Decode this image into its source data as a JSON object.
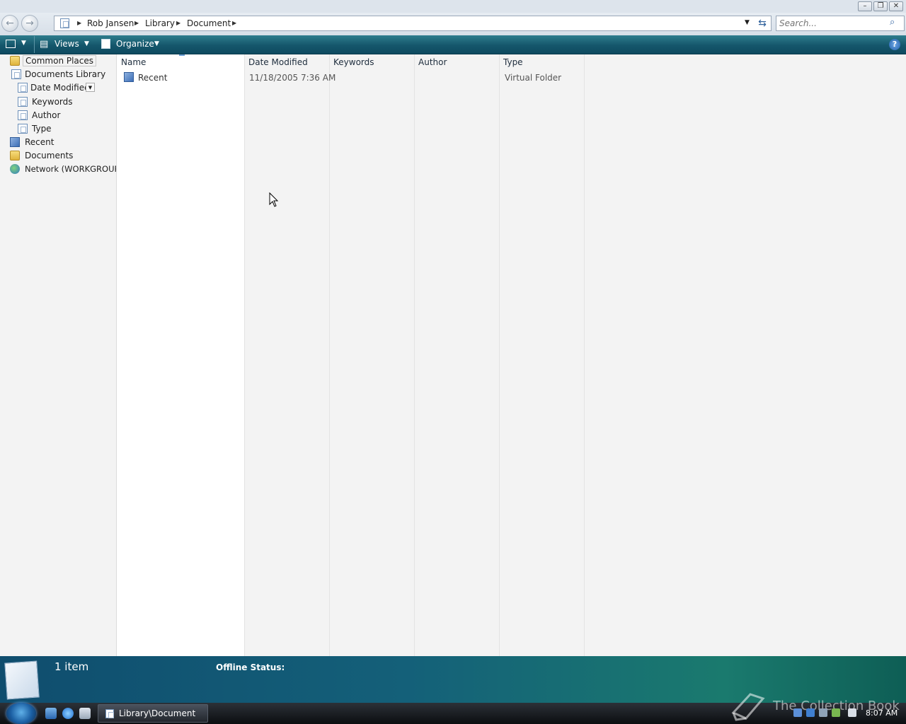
{
  "window": {
    "caption_buttons": {
      "minimize": "–",
      "restore": "❐",
      "close": "✕"
    }
  },
  "address": {
    "breadcrumbs": [
      "Rob Jansen",
      "Library",
      "Document"
    ],
    "search_placeholder": "Search..."
  },
  "toolbar": {
    "views_label": "Views",
    "organize_label": "Organize",
    "help_label": "?"
  },
  "nav": {
    "items": [
      {
        "label": "Common Places",
        "icon": "folder-icon"
      },
      {
        "label": "Documents Library",
        "icon": "document-icon"
      },
      {
        "label": "Date Modified",
        "icon": "document-icon"
      },
      {
        "label": "Keywords",
        "icon": "document-icon"
      },
      {
        "label": "Author",
        "icon": "document-icon"
      },
      {
        "label": "Type",
        "icon": "document-icon"
      },
      {
        "label": "Recent",
        "icon": "recent-folder-icon"
      },
      {
        "label": "Documents",
        "icon": "folder-icon"
      },
      {
        "label": "Network (WORKGROUP",
        "icon": "network-icon"
      }
    ]
  },
  "list": {
    "columns": [
      "Name",
      "Date Modified",
      "Keywords",
      "Author",
      "Type"
    ],
    "rows": [
      {
        "name": "Recent",
        "date_modified": "11/18/2005 7:36 AM",
        "keywords": "",
        "author": "",
        "type": "Virtual Folder"
      }
    ]
  },
  "details": {
    "item_count": "1 item",
    "offline_status_label": "Offline Status:"
  },
  "taskbar": {
    "task_button_label": "Library\\Document",
    "clock": "8:07 AM",
    "watermark": "The Collection Book"
  },
  "colors": {
    "toolbar": "#15566b",
    "details_pane": "#146079",
    "taskbar": "#0b0d10"
  }
}
